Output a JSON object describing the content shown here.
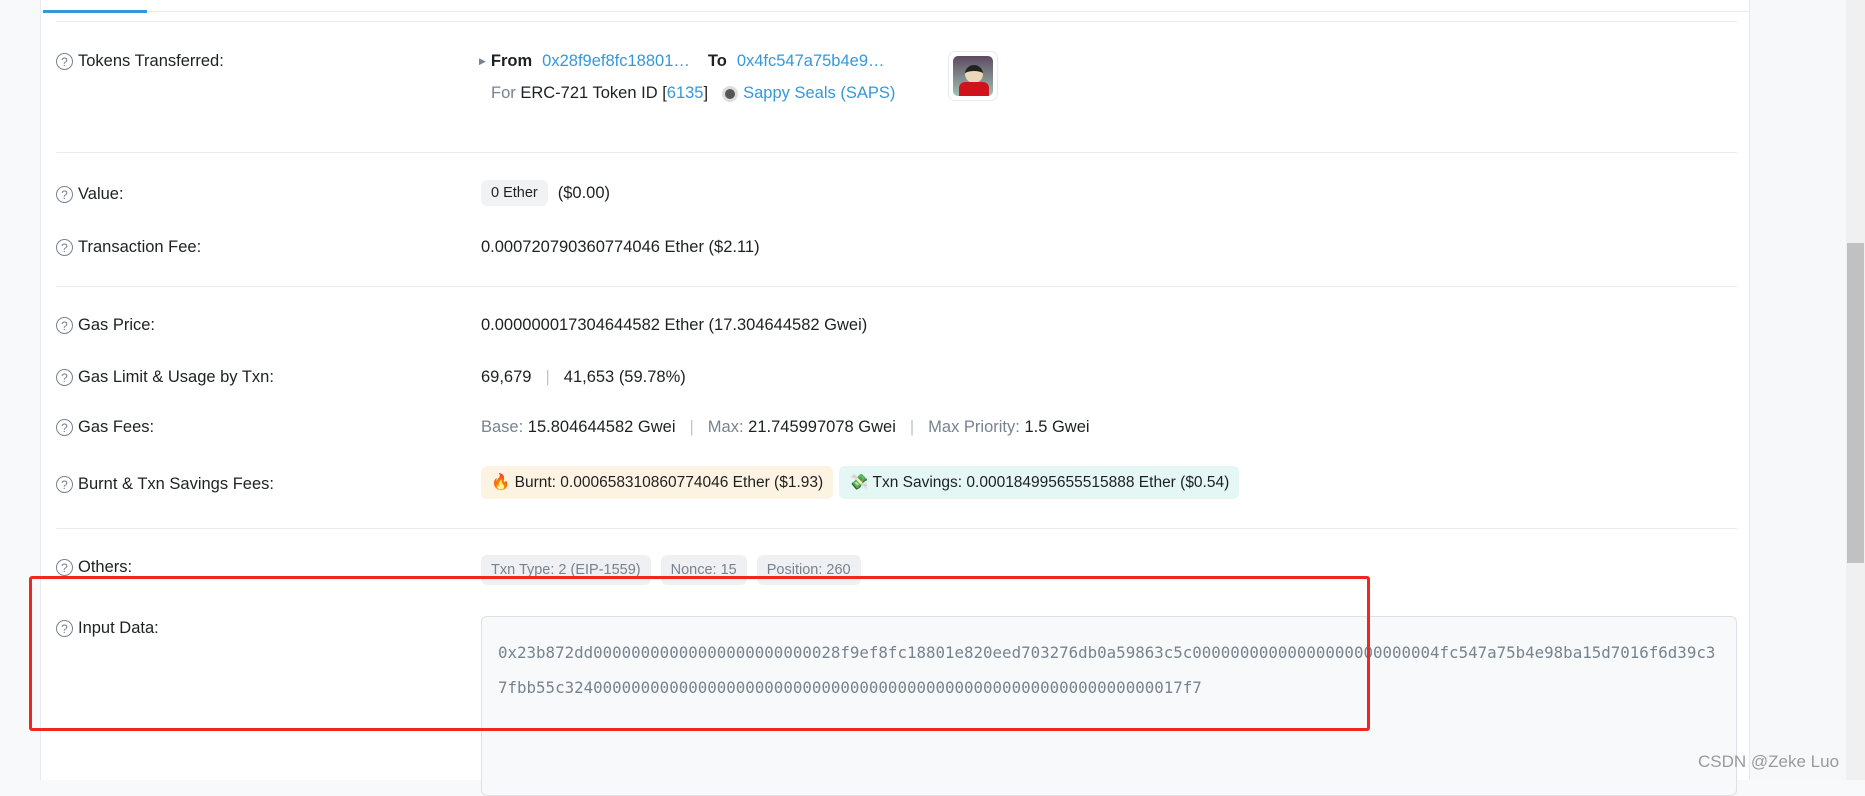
{
  "tokens": {
    "label": "Tokens Transferred:",
    "from_label": "From",
    "from_address": "0x28f9ef8fc18801…",
    "to_label": "To",
    "to_address": "0x4fc547a75b4e9…",
    "for_label": "For",
    "token_standard": "ERC-721 Token ID [",
    "token_id": "6135",
    "bracket_close": "]",
    "collection": "Sappy Seals (SAPS)"
  },
  "value": {
    "label": "Value:",
    "amount": "0 Ether",
    "usd": "($0.00)"
  },
  "fee": {
    "label": "Transaction Fee:",
    "value": "0.000720790360774046 Ether ($2.11)"
  },
  "gas_price": {
    "label": "Gas Price:",
    "value": "0.000000017304644582 Ether (17.304644582 Gwei)"
  },
  "gas_limit": {
    "label": "Gas Limit & Usage by Txn:",
    "limit": "69,679",
    "separator": "|",
    "usage": "41,653 (59.78%)"
  },
  "gas_fees": {
    "label": "Gas Fees:",
    "base_label": "Base:",
    "base": "15.804644582 Gwei",
    "max_label": "Max:",
    "max": "21.745997078 Gwei",
    "priority_label": "Max Priority:",
    "priority": "1.5 Gwei",
    "separator": "|"
  },
  "burnt": {
    "label": "Burnt & Txn Savings Fees:",
    "burnt": "Burnt: 0.000658310860774046 Ether ($1.93)",
    "savings": "Txn Savings: 0.000184995655515888 Ether ($0.54)"
  },
  "others": {
    "label": "Others:",
    "txn_type": "Txn Type: 2 (EIP-1559)",
    "nonce": "Nonce: 15",
    "position": "Position: 260"
  },
  "input": {
    "label": "Input Data:",
    "value": "0x23b872dd00000000000000000000000028f9ef8fc18801e820eed703276db0a59863c5c00000000000000000000000004fc547a75b4e98ba15d7016f6d39c37fbb55c32400000000000000000000000000000000000000000000000000000000000017f7"
  },
  "watermark": "CSDN @Zeke Luo",
  "colors": {
    "link": "#3498db",
    "highlight_box": "#f0261f"
  }
}
